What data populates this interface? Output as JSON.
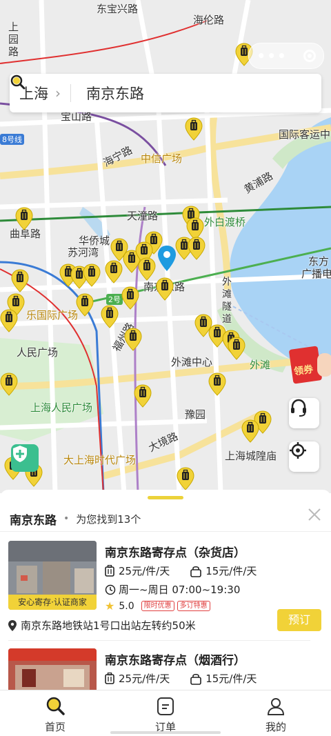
{
  "colors": {
    "accent": "#f1d238",
    "primary_text": "#222222",
    "route_red": "#e03030"
  },
  "header": {
    "city": "上海",
    "search_value": "南京东路"
  },
  "map": {
    "labels": [
      {
        "text": "东宝兴路",
        "cls": ""
      },
      {
        "text": "海伦路",
        "cls": ""
      },
      {
        "text": "上\n园\n路",
        "cls": ""
      },
      {
        "text": "宝山路",
        "cls": ""
      },
      {
        "text": "国际客运中",
        "cls": ""
      },
      {
        "text": "海宁路",
        "cls": ""
      },
      {
        "text": "中信广场",
        "cls": "orange"
      },
      {
        "text": "黄浦路",
        "cls": ""
      },
      {
        "text": "天潼路",
        "cls": ""
      },
      {
        "text": "外白渡桥",
        "cls": "green"
      },
      {
        "text": "华侨城",
        "cls": ""
      },
      {
        "text": "苏河湾",
        "cls": ""
      },
      {
        "text": "曲阜路",
        "cls": ""
      },
      {
        "text": "南京东路",
        "cls": ""
      },
      {
        "text": "东方",
        "cls": ""
      },
      {
        "text": "广播电",
        "cls": ""
      },
      {
        "text": "外滩隧道",
        "cls": ""
      },
      {
        "text": "乐国际广场",
        "cls": "orange"
      },
      {
        "text": "福州路",
        "cls": ""
      },
      {
        "text": "人民广场",
        "cls": ""
      },
      {
        "text": "外滩中心",
        "cls": ""
      },
      {
        "text": "外滩",
        "cls": "green"
      },
      {
        "text": "上海人民广场",
        "cls": "green"
      },
      {
        "text": "豫园",
        "cls": ""
      },
      {
        "text": "大境路",
        "cls": ""
      },
      {
        "text": "大上海时代广场",
        "cls": "orange"
      },
      {
        "text": "上海城隍庙",
        "cls": ""
      }
    ],
    "line_badges": [
      "8号线",
      "2号"
    ],
    "coupon_label": "领券"
  },
  "results": {
    "keyword": "南京东路",
    "count_text": "为您找到13个"
  },
  "stores": [
    {
      "title": "南京东路寄存点（杂货店）",
      "price_luggage": "25元/件/天",
      "price_bag": "15元/件/天",
      "hours": "周一~周日 07:00~19:30",
      "rating": "5.0",
      "tags": [
        "限时优惠",
        "多订特惠"
      ],
      "badge": "安心寄存·认证商家",
      "address": "南京东路地铁站1号口出站左转约50米",
      "book": "预订"
    },
    {
      "title": "南京东路寄存点（烟酒行）",
      "price_luggage": "25元/件/天",
      "price_bag": "15元/件/天"
    }
  ],
  "tabbar": {
    "home": "首页",
    "orders": "订单",
    "mine": "我的"
  }
}
